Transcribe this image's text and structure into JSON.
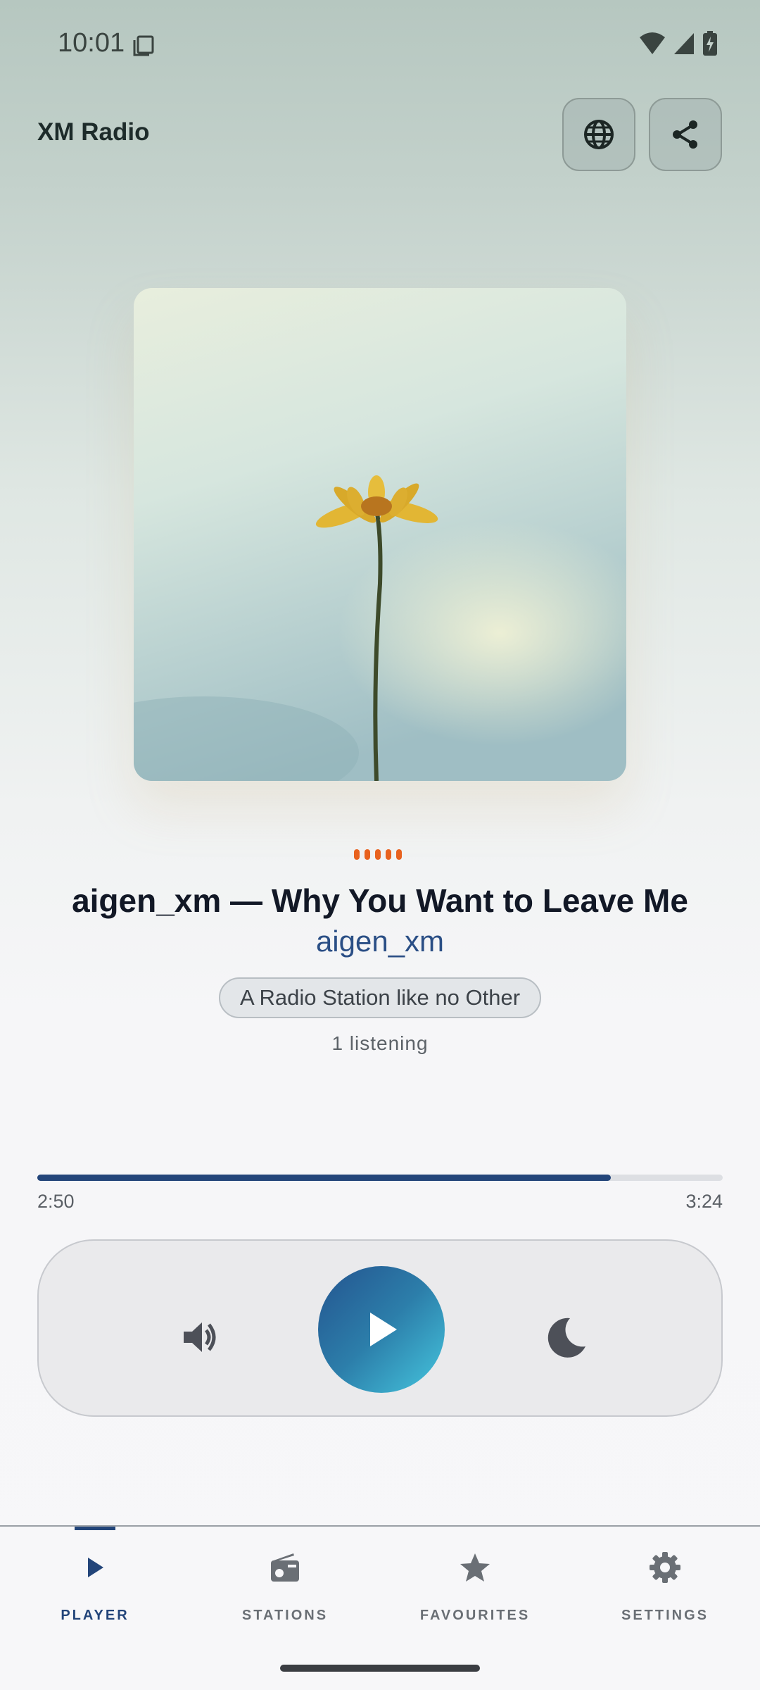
{
  "status_bar": {
    "time": "10:01"
  },
  "header": {
    "title": "XM Radio"
  },
  "now_playing": {
    "title": "aigen_xm — Why You Want to Leave Me",
    "artist": "aigen_xm",
    "station_tagline": "A Radio Station like no Other",
    "listeners": "1 listening"
  },
  "progress": {
    "elapsed": "2:50",
    "total": "3:24",
    "fraction": 0.837
  },
  "controls": {
    "volume_icon": "volume-icon",
    "play_icon": "play-icon",
    "sleep_icon": "moon-icon"
  },
  "nav": {
    "items": [
      {
        "label": "PLAYER",
        "icon": "play-icon",
        "active": true
      },
      {
        "label": "STATIONS",
        "icon": "radio-icon",
        "active": false
      },
      {
        "label": "FAVOURITES",
        "icon": "star-icon",
        "active": false
      },
      {
        "label": "SETTINGS",
        "icon": "gear-icon",
        "active": false
      }
    ]
  },
  "colors": {
    "accent": "#23457a",
    "eq_dots": "#e8621e",
    "play_gradient_start": "#24548f",
    "play_gradient_end": "#45c6de"
  }
}
